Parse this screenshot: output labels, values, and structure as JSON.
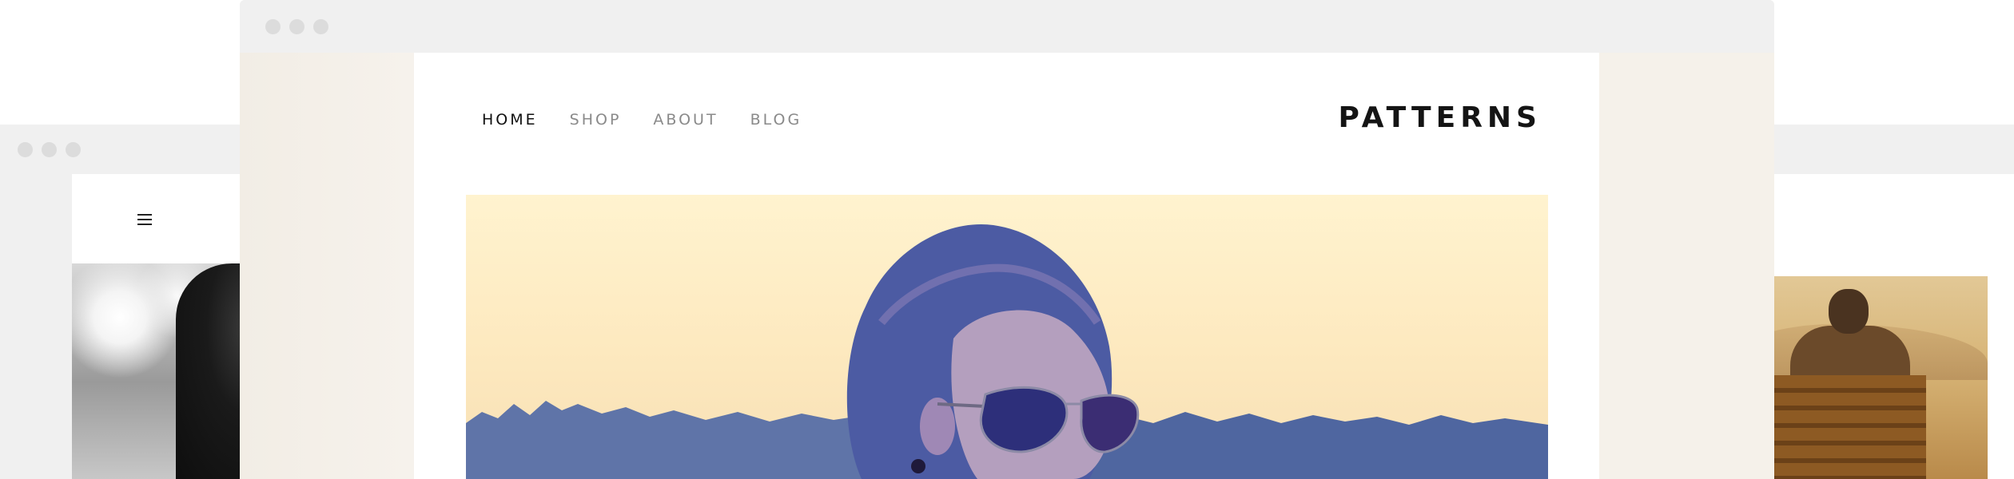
{
  "center_window": {
    "site": {
      "brand": "PATTERNS",
      "nav": [
        {
          "label": "HOME",
          "active": true
        },
        {
          "label": "SHOP",
          "active": false
        },
        {
          "label": "ABOUT",
          "active": false
        },
        {
          "label": "BLOG",
          "active": false
        }
      ],
      "hero_image": "woman-in-aviator-sunglasses-photo"
    }
  },
  "left_window": {
    "menu_icon": "hamburger-menu-icon",
    "image": "woman-with-sun-bokeh-photo"
  },
  "right_window": {
    "image": "man-on-bench-photo"
  },
  "colors": {
    "chrome": "#f0f0f0",
    "traffic_dot": "#dcdcdc",
    "page_margin": "#f5f1ea",
    "nav_active": "#111111",
    "nav_inactive": "#8a8a8a",
    "brand": "#141414"
  }
}
